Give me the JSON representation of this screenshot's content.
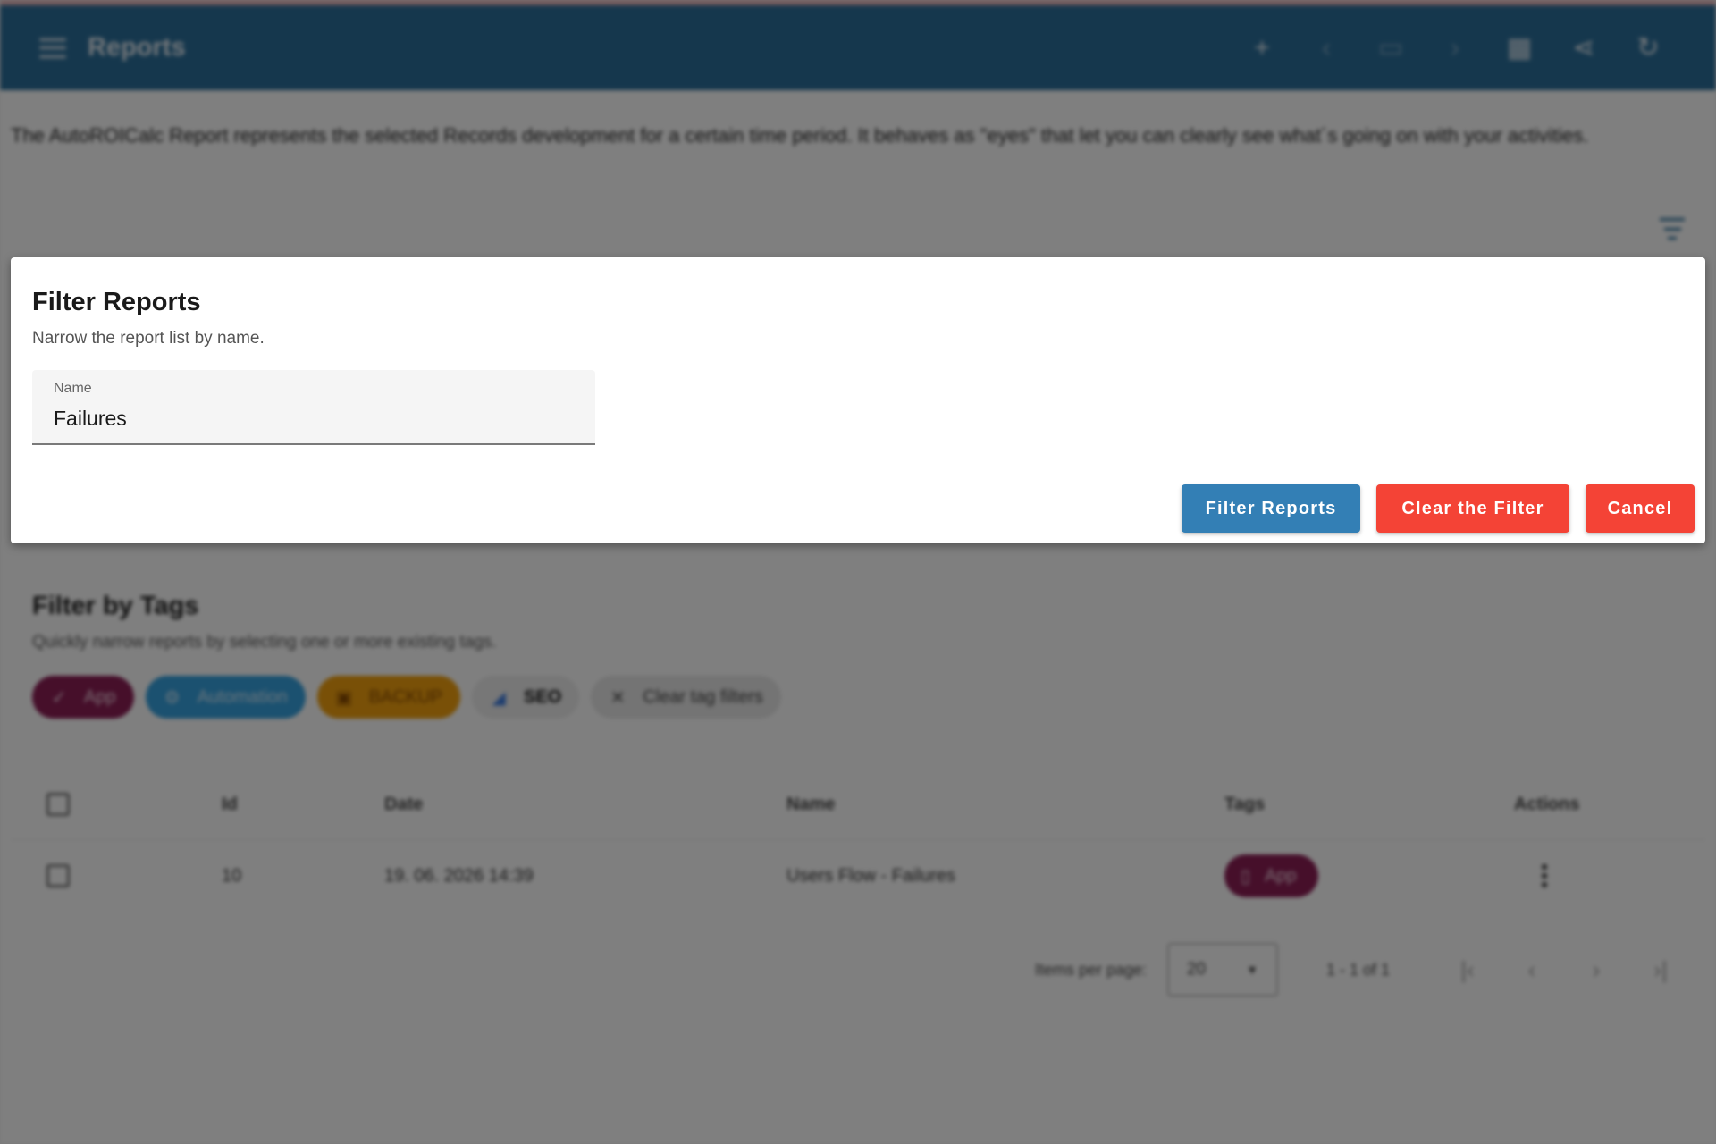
{
  "topbar": {
    "title": "Reports",
    "actions": [
      {
        "name": "add-icon",
        "glyph": "+"
      },
      {
        "name": "chevron-left-icon",
        "glyph": "‹"
      },
      {
        "name": "calendar-icon",
        "glyph": "▭"
      },
      {
        "name": "chevron-right-icon",
        "glyph": "›"
      },
      {
        "name": "grid-icon",
        "glyph": "▦"
      },
      {
        "name": "share-icon",
        "glyph": "⋖"
      },
      {
        "name": "refresh-icon",
        "glyph": "↻"
      }
    ]
  },
  "description": "The AutoROICalc Report represents the selected Records development for a certain time period. It behaves as \"eyes\" that let you can clearly see what´s going on with your activities.",
  "tags_section": {
    "title": "Filter by Tags",
    "subtitle": "Quickly narrow reports by selecting one or more existing tags.",
    "chips": [
      {
        "label": "App",
        "icon": "check-icon",
        "color": "#8c1e55"
      },
      {
        "label": "Automation",
        "icon": "gear-icon",
        "color": "#36a2e0"
      },
      {
        "label": "BACKUP",
        "icon": "backup-icon",
        "color": "#f2a10f"
      },
      {
        "label": "SEO",
        "icon": "ads-icon",
        "color": "#eeeeee"
      },
      {
        "label": "Clear tag filters",
        "icon": "close-icon",
        "color": "#e8e8e8"
      }
    ]
  },
  "table": {
    "headers": {
      "id": "Id",
      "date": "Date",
      "name": "Name",
      "tags": "Tags",
      "actions": "Actions"
    },
    "rows": [
      {
        "id": "10",
        "date": "19. 06. 2026 14:39",
        "name": "Users Flow - Failures",
        "tag": "App"
      }
    ]
  },
  "pager": {
    "items_per_page_label": "Items per page:",
    "page_size": "20",
    "range": "1 - 1 of 1"
  },
  "dialog": {
    "title": "Filter Reports",
    "subtitle": "Narrow the report list by name.",
    "name_label": "Name",
    "name_value": "Failures",
    "filter_button": "Filter Reports",
    "clear_button": "Clear the Filter",
    "cancel_button": "Cancel"
  },
  "colors": {
    "topbar": "#2b6f9b",
    "primary_button": "#337fb5",
    "danger_button": "#f44336"
  }
}
